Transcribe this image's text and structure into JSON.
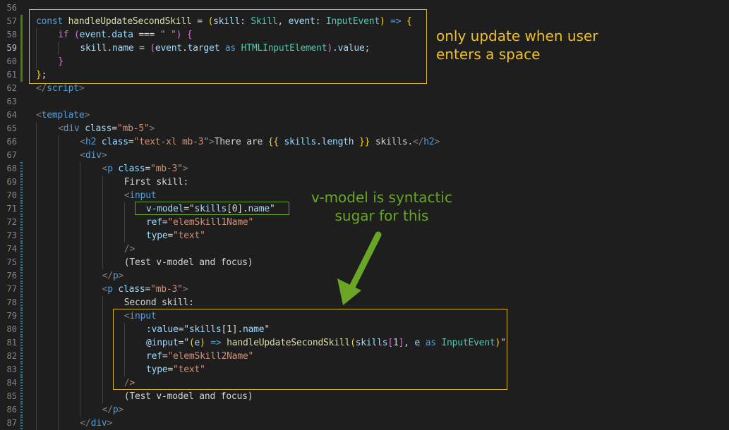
{
  "lines": [
    {
      "n": "56",
      "gut": "",
      "guides": 0,
      "tokens": []
    },
    {
      "n": "57",
      "gut": "add",
      "guides": 0,
      "tokens": [
        [
          "k",
          "const"
        ],
        [
          "p",
          " "
        ],
        [
          "f",
          "handleUpdateSecondSkill"
        ],
        [
          "p",
          " = "
        ],
        [
          "y",
          "("
        ],
        [
          "v",
          "skill"
        ],
        [
          "p",
          ": "
        ],
        [
          "t",
          "Skill"
        ],
        [
          "p",
          ", "
        ],
        [
          "v",
          "event"
        ],
        [
          "p",
          ": "
        ],
        [
          "t",
          "InputEvent"
        ],
        [
          "y",
          ")"
        ],
        [
          "p",
          " "
        ],
        [
          "k",
          "=>"
        ],
        [
          "p",
          " "
        ],
        [
          "y",
          "{"
        ]
      ]
    },
    {
      "n": "58",
      "gut": "add",
      "guides": 1,
      "tokens": [
        [
          "c",
          "if"
        ],
        [
          "p",
          " "
        ],
        [
          "pu",
          "("
        ],
        [
          "v",
          "event"
        ],
        [
          "p",
          "."
        ],
        [
          "v",
          "data"
        ],
        [
          "p",
          " === "
        ],
        [
          "s",
          "\" \""
        ],
        [
          "pu",
          ")"
        ],
        [
          "p",
          " "
        ],
        [
          "pu",
          "{"
        ]
      ]
    },
    {
      "n": "59",
      "gut": "add",
      "guides": 2,
      "active": true,
      "tokens": [
        [
          "v",
          "skill"
        ],
        [
          "p",
          "."
        ],
        [
          "v",
          "name"
        ],
        [
          "p",
          " = "
        ],
        [
          "pu",
          "("
        ],
        [
          "v",
          "event"
        ],
        [
          "p",
          "."
        ],
        [
          "v",
          "target"
        ],
        [
          "p",
          " "
        ],
        [
          "k",
          "as"
        ],
        [
          "p",
          " "
        ],
        [
          "t",
          "HTMLInputElement"
        ],
        [
          "pu",
          ")"
        ],
        [
          "p",
          "."
        ],
        [
          "v",
          "value"
        ],
        [
          "p",
          ";"
        ]
      ]
    },
    {
      "n": "60",
      "gut": "add",
      "guides": 1,
      "tokens": [
        [
          "pu",
          "}"
        ]
      ]
    },
    {
      "n": "61",
      "gut": "add",
      "guides": 0,
      "tokens": [
        [
          "y",
          "}"
        ],
        [
          "p",
          ";"
        ]
      ]
    },
    {
      "n": "62",
      "gut": "",
      "guides": 0,
      "tokens": [
        [
          "tg",
          "</"
        ],
        [
          "tn",
          "script"
        ],
        [
          "tg",
          ">"
        ]
      ]
    },
    {
      "n": "63",
      "gut": "",
      "guides": 0,
      "tokens": []
    },
    {
      "n": "64",
      "gut": "",
      "guides": 0,
      "tokens": [
        [
          "tg",
          "<"
        ],
        [
          "tn",
          "template"
        ],
        [
          "tg",
          ">"
        ]
      ]
    },
    {
      "n": "65",
      "gut": "",
      "guides": 1,
      "tokens": [
        [
          "tg",
          "<"
        ],
        [
          "tn",
          "div"
        ],
        [
          "p",
          " "
        ],
        [
          "at",
          "class"
        ],
        [
          "p",
          "="
        ],
        [
          "s",
          "\"mb-5\""
        ],
        [
          "tg",
          ">"
        ]
      ]
    },
    {
      "n": "66",
      "gut": "",
      "guides": 2,
      "tokens": [
        [
          "tg",
          "<"
        ],
        [
          "tn",
          "h2"
        ],
        [
          "p",
          " "
        ],
        [
          "at",
          "class"
        ],
        [
          "p",
          "="
        ],
        [
          "s",
          "\"text-xl mb-3\""
        ],
        [
          "tg",
          ">"
        ],
        [
          "p",
          "There are "
        ],
        [
          "y",
          "{{"
        ],
        [
          "p",
          " "
        ],
        [
          "v",
          "skills"
        ],
        [
          "p",
          "."
        ],
        [
          "v",
          "length"
        ],
        [
          "p",
          " "
        ],
        [
          "y",
          "}}"
        ],
        [
          "p",
          " skills."
        ],
        [
          "tg",
          "</"
        ],
        [
          "tn",
          "h2"
        ],
        [
          "tg",
          ">"
        ]
      ]
    },
    {
      "n": "67",
      "gut": "",
      "guides": 2,
      "tokens": [
        [
          "tg",
          "<"
        ],
        [
          "tn",
          "div"
        ],
        [
          "tg",
          ">"
        ]
      ]
    },
    {
      "n": "68",
      "gut": "mod",
      "guides": 3,
      "tokens": [
        [
          "tg",
          "<"
        ],
        [
          "tn",
          "p"
        ],
        [
          "p",
          " "
        ],
        [
          "at",
          "class"
        ],
        [
          "p",
          "="
        ],
        [
          "s",
          "\"mb-3\""
        ],
        [
          "tg",
          ">"
        ]
      ]
    },
    {
      "n": "69",
      "gut": "mod",
      "guides": 4,
      "tokens": [
        [
          "p",
          "First skill:"
        ]
      ]
    },
    {
      "n": "70",
      "gut": "mod",
      "guides": 4,
      "tokens": [
        [
          "tg",
          "<"
        ],
        [
          "tn",
          "input"
        ]
      ]
    },
    {
      "n": "71",
      "gut": "mod",
      "guides": 5,
      "tokens": [
        [
          "at",
          "v-model"
        ],
        [
          "p",
          "="
        ],
        [
          "p",
          "\""
        ],
        [
          "v",
          "skills"
        ],
        [
          "p",
          "["
        ],
        [
          "p",
          "0"
        ],
        [
          "p",
          "]."
        ],
        [
          "v",
          "name"
        ],
        [
          "p",
          "\""
        ]
      ]
    },
    {
      "n": "72",
      "gut": "mod",
      "guides": 5,
      "tokens": [
        [
          "at",
          "ref"
        ],
        [
          "p",
          "="
        ],
        [
          "s",
          "\"elemSkill1Name\""
        ]
      ]
    },
    {
      "n": "73",
      "gut": "mod",
      "guides": 5,
      "tokens": [
        [
          "at",
          "type"
        ],
        [
          "p",
          "="
        ],
        [
          "s",
          "\"text\""
        ]
      ]
    },
    {
      "n": "74",
      "gut": "mod",
      "guides": 4,
      "tokens": [
        [
          "tg",
          "/>"
        ]
      ]
    },
    {
      "n": "75",
      "gut": "mod",
      "guides": 4,
      "tokens": [
        [
          "p",
          "(Test v-model and focus)"
        ]
      ]
    },
    {
      "n": "76",
      "gut": "mod",
      "guides": 3,
      "tokens": [
        [
          "tg",
          "</"
        ],
        [
          "tn",
          "p"
        ],
        [
          "tg",
          ">"
        ]
      ]
    },
    {
      "n": "77",
      "gut": "mod",
      "guides": 3,
      "tokens": [
        [
          "tg",
          "<"
        ],
        [
          "tn",
          "p"
        ],
        [
          "p",
          " "
        ],
        [
          "at",
          "class"
        ],
        [
          "p",
          "="
        ],
        [
          "s",
          "\"mb-3\""
        ],
        [
          "tg",
          ">"
        ]
      ]
    },
    {
      "n": "78",
      "gut": "mod",
      "guides": 4,
      "tokens": [
        [
          "p",
          "Second skill:"
        ]
      ]
    },
    {
      "n": "79",
      "gut": "mod",
      "guides": 4,
      "tokens": [
        [
          "tg",
          "<"
        ],
        [
          "tn",
          "input"
        ]
      ]
    },
    {
      "n": "80",
      "gut": "mod",
      "guides": 5,
      "tokens": [
        [
          "at",
          ":value"
        ],
        [
          "p",
          "="
        ],
        [
          "p",
          "\""
        ],
        [
          "v",
          "skills"
        ],
        [
          "p",
          "["
        ],
        [
          "p",
          "1"
        ],
        [
          "p",
          "]."
        ],
        [
          "v",
          "name"
        ],
        [
          "p",
          "\""
        ]
      ]
    },
    {
      "n": "81",
      "gut": "mod",
      "guides": 5,
      "tokens": [
        [
          "at",
          "@input"
        ],
        [
          "p",
          "="
        ],
        [
          "p",
          "\""
        ],
        [
          "y",
          "("
        ],
        [
          "v",
          "e"
        ],
        [
          "y",
          ")"
        ],
        [
          "p",
          " "
        ],
        [
          "k",
          "=>"
        ],
        [
          "p",
          " "
        ],
        [
          "f",
          "handleUpdateSecondSkill"
        ],
        [
          "y",
          "("
        ],
        [
          "v",
          "skills"
        ],
        [
          "pu",
          "["
        ],
        [
          "p",
          "1"
        ],
        [
          "pu",
          "]"
        ],
        [
          "p",
          ", "
        ],
        [
          "v",
          "e"
        ],
        [
          "p",
          " "
        ],
        [
          "k",
          "as"
        ],
        [
          "p",
          " "
        ],
        [
          "t",
          "InputEvent"
        ],
        [
          "y",
          ")"
        ],
        [
          "p",
          "\""
        ]
      ]
    },
    {
      "n": "82",
      "gut": "mod",
      "guides": 5,
      "tokens": [
        [
          "at",
          "ref"
        ],
        [
          "p",
          "="
        ],
        [
          "s",
          "\"elemSkill2Name\""
        ]
      ]
    },
    {
      "n": "83",
      "gut": "mod",
      "guides": 5,
      "tokens": [
        [
          "at",
          "type"
        ],
        [
          "p",
          "="
        ],
        [
          "s",
          "\"text\""
        ]
      ]
    },
    {
      "n": "84",
      "gut": "mod",
      "guides": 4,
      "tokens": [
        [
          "tg",
          "/"
        ],
        [
          "s",
          ">"
        ]
      ]
    },
    {
      "n": "85",
      "gut": "mod",
      "guides": 4,
      "tokens": [
        [
          "p",
          "(Test v-model and focus)"
        ]
      ]
    },
    {
      "n": "86",
      "gut": "mod",
      "guides": 3,
      "tokens": [
        [
          "tg",
          "</"
        ],
        [
          "tn",
          "p"
        ],
        [
          "tg",
          ">"
        ]
      ]
    },
    {
      "n": "87",
      "gut": "mod",
      "guides": 2,
      "tokens": [
        [
          "tg",
          "</"
        ],
        [
          "tn",
          "div"
        ],
        [
          "tg",
          ">"
        ]
      ]
    }
  ],
  "annotations": {
    "top_note_line1": "only update when user",
    "top_note_line2": "enters a space",
    "green_note_line1": "v-model is  syntactic",
    "green_note_line2": "sugar for this",
    "yellow": "#f0c020",
    "green": "#6aa626"
  }
}
